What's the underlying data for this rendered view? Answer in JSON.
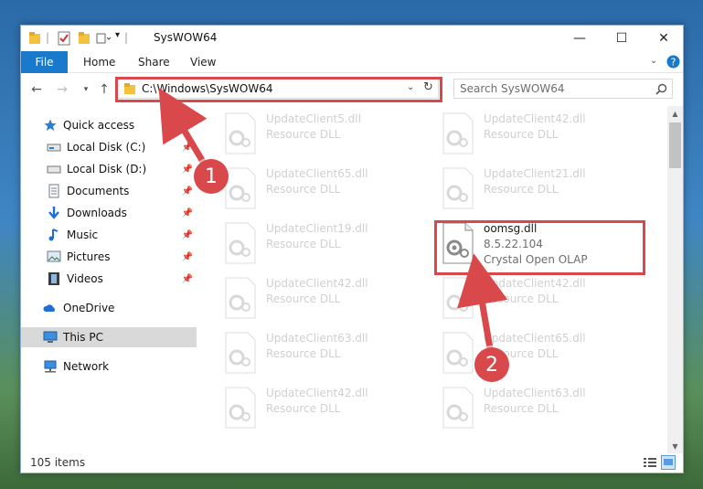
{
  "window": {
    "title": "SysWOW64",
    "controls": {
      "minimize": "—",
      "maximize": "☐",
      "close": "✕"
    }
  },
  "ribbon": {
    "tabs": [
      "File",
      "Home",
      "Share",
      "View"
    ]
  },
  "nav": {
    "address": "C:\\Windows\\SysWOW64",
    "search_placeholder": "Search SysWOW64"
  },
  "sidebar": {
    "items": [
      {
        "label": "Quick access",
        "pinned": false
      },
      {
        "label": "Local Disk (C:)",
        "pinned": true
      },
      {
        "label": "Local Disk (D:)",
        "pinned": true
      },
      {
        "label": "Documents",
        "pinned": true
      },
      {
        "label": "Downloads",
        "pinned": true
      },
      {
        "label": "Music",
        "pinned": true
      },
      {
        "label": "Pictures",
        "pinned": true
      },
      {
        "label": "Videos",
        "pinned": true
      },
      {
        "label": "OneDrive",
        "pinned": false
      },
      {
        "label": "This PC",
        "pinned": false,
        "selected": true
      },
      {
        "label": "Network",
        "pinned": false
      }
    ]
  },
  "files": [
    {
      "name": "UpdateClient5.dll",
      "type": "Resource DLL"
    },
    {
      "name": "UpdateClient42.dll",
      "type": "Resource DLL"
    },
    {
      "name": "UpdateClient65.dll",
      "type": "Resource DLL"
    },
    {
      "name": "UpdateClient21.dll",
      "type": "Resource DLL"
    },
    {
      "name": "UpdateClient19.dll",
      "type": "Resource DLL"
    },
    {
      "name": "oomsg.dll",
      "type": "8.5.22.104",
      "company": "Crystal Open OLAP"
    },
    {
      "name": "UpdateClient42.dll",
      "type": "Resource DLL"
    },
    {
      "name": "UpdateClient42.dll",
      "type": "Resource DLL"
    },
    {
      "name": "UpdateClient63.dll",
      "type": "Resource DLL"
    },
    {
      "name": "UpdateClient65.dll",
      "type": "Resource DLL"
    },
    {
      "name": "UpdateClient42.dll",
      "type": "Resource DLL"
    },
    {
      "name": "UpdateClient63.dll",
      "type": "Resource DLL"
    }
  ],
  "status": {
    "items": "105 items"
  },
  "annotations": {
    "step1": "1",
    "step2": "2"
  },
  "colors": {
    "accent": "#1979ca",
    "highlight": "#d9484a"
  }
}
